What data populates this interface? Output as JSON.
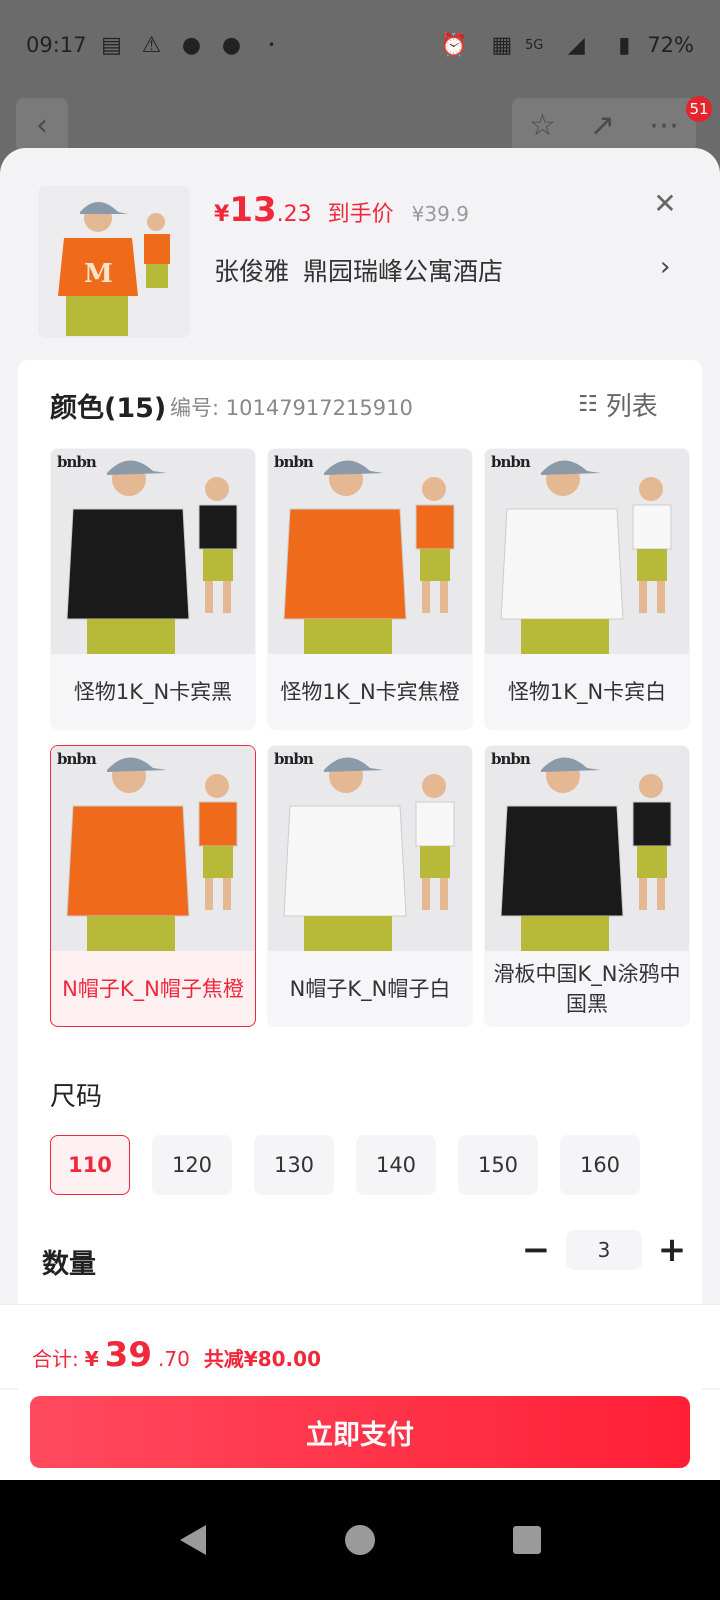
{
  "status": {
    "time": "09:17",
    "battery": "72%",
    "net": "5G"
  },
  "badge_count": "51",
  "product": {
    "price_symbol": "¥",
    "price_int": "13",
    "price_dec": ".23",
    "price_label": "到手价",
    "price_orig": "¥39.9",
    "receiver": "张俊雅",
    "address": "鼎园瑞峰公寓酒店"
  },
  "color_section": {
    "title": "颜色(15)",
    "code": "编号: 10147917215910",
    "list_label": "列表",
    "logo_text": "bnbn",
    "items": [
      {
        "label": "怪物1K_N卡宾黑",
        "shirt": "#1a1a1a",
        "side": "#1a1a1a"
      },
      {
        "label": "怪物1K_N卡宾焦橙",
        "shirt": "#f06a1c",
        "side": "#f06a1c"
      },
      {
        "label": "怪物1K_N卡宾白",
        "shirt": "#f7f7f7",
        "side": "#f7f7f7"
      },
      {
        "label": "N帽子K_N帽子焦橙",
        "shirt": "#f06a1c",
        "side": "#f06a1c"
      },
      {
        "label": "N帽子K_N帽子白",
        "shirt": "#f7f7f7",
        "side": "#f7f7f7"
      },
      {
        "label": "滑板中国K_N涂鸦中国黑",
        "shirt": "#1a1a1a",
        "side": "#1a1a1a"
      }
    ]
  },
  "size_section": {
    "title": "尺码",
    "sizes": [
      "110",
      "120",
      "130",
      "140",
      "150",
      "160"
    ],
    "selected": "110"
  },
  "qty_section": {
    "title": "数量",
    "value": "3",
    "minus": "−",
    "plus": "+"
  },
  "total": {
    "label": "合计:",
    "symbol": "¥",
    "int": "39",
    "dec": ".70",
    "save": "共减¥80.00"
  },
  "pay_button": "立即支付",
  "colors": {
    "accent": "#f0283c",
    "pay_start": "#ff4a5f",
    "pay_end": "#ff1f35"
  }
}
